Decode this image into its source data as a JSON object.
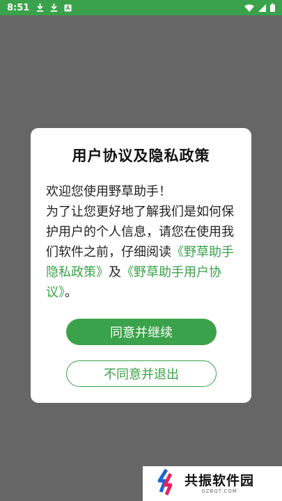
{
  "status_bar": {
    "time": "8:51",
    "icons_left": [
      "download-icon",
      "download-icon",
      "a-app-icon"
    ],
    "icons_right": [
      "wifi-icon",
      "signal-icon",
      "battery-icon"
    ],
    "color": "#3aa24a"
  },
  "dialog": {
    "title": "用户协议及隐私政策",
    "line1": "欢迎您使用野草助手！",
    "line2_plain": "为了让您更好地了解我们是如何保护用户的个人信息，请您在使用我们软件之前，仔细阅读",
    "privacy_link": "《野草助手隐私政策》",
    "and_text": "及",
    "agreement_link": "《野草助手用户协议》",
    "end_text": "。",
    "agree_button": "同意并继续",
    "disagree_button": "不同意并退出",
    "accent_color": "#3aa24a"
  },
  "watermark": {
    "name": "共振软件园",
    "domain": "GZBQT.COM"
  }
}
